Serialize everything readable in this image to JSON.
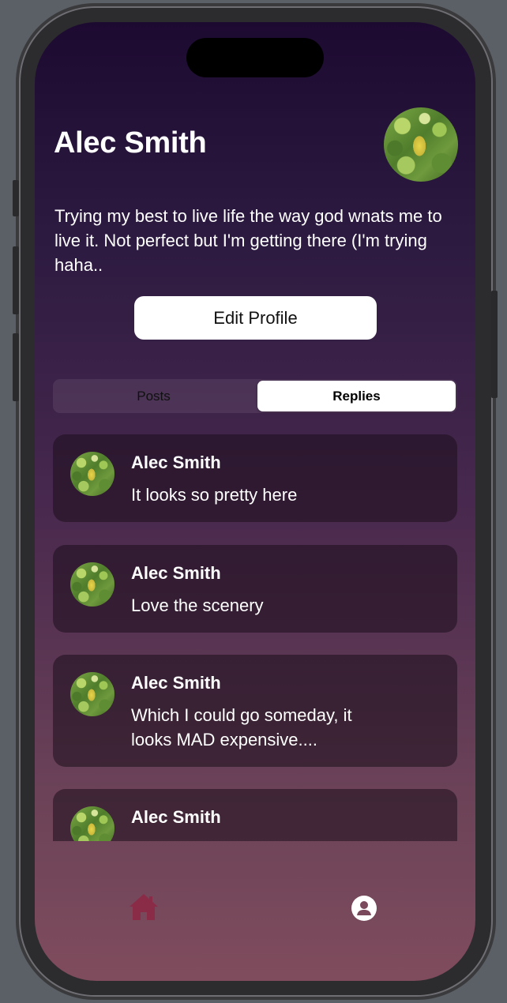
{
  "profile": {
    "name": "Alec Smith",
    "bio": "Trying my best to live life the way god wnats me to live it. Not perfect but I'm getting there (I'm trying haha..",
    "edit_label": "Edit Profile"
  },
  "tabs": {
    "posts_label": "Posts",
    "replies_label": "Replies",
    "selected": "Replies"
  },
  "replies": [
    {
      "author": "Alec Smith",
      "text": "It looks so pretty here"
    },
    {
      "author": "Alec Smith",
      "text": "Love the scenery"
    },
    {
      "author": "Alec Smith",
      "text": "Which I could go someday, it looks MAD expensive...."
    },
    {
      "author": "Alec Smith",
      "text": ""
    }
  ],
  "tab_bar": {
    "home_icon": "house-icon",
    "profile_icon": "person-circle-icon",
    "selected": "profile"
  },
  "colors": {
    "home_tab": "#8a2c48",
    "profile_tab": "#ffffff",
    "background_top": "#1d0a31",
    "background_bottom": "#7f4c5d"
  }
}
